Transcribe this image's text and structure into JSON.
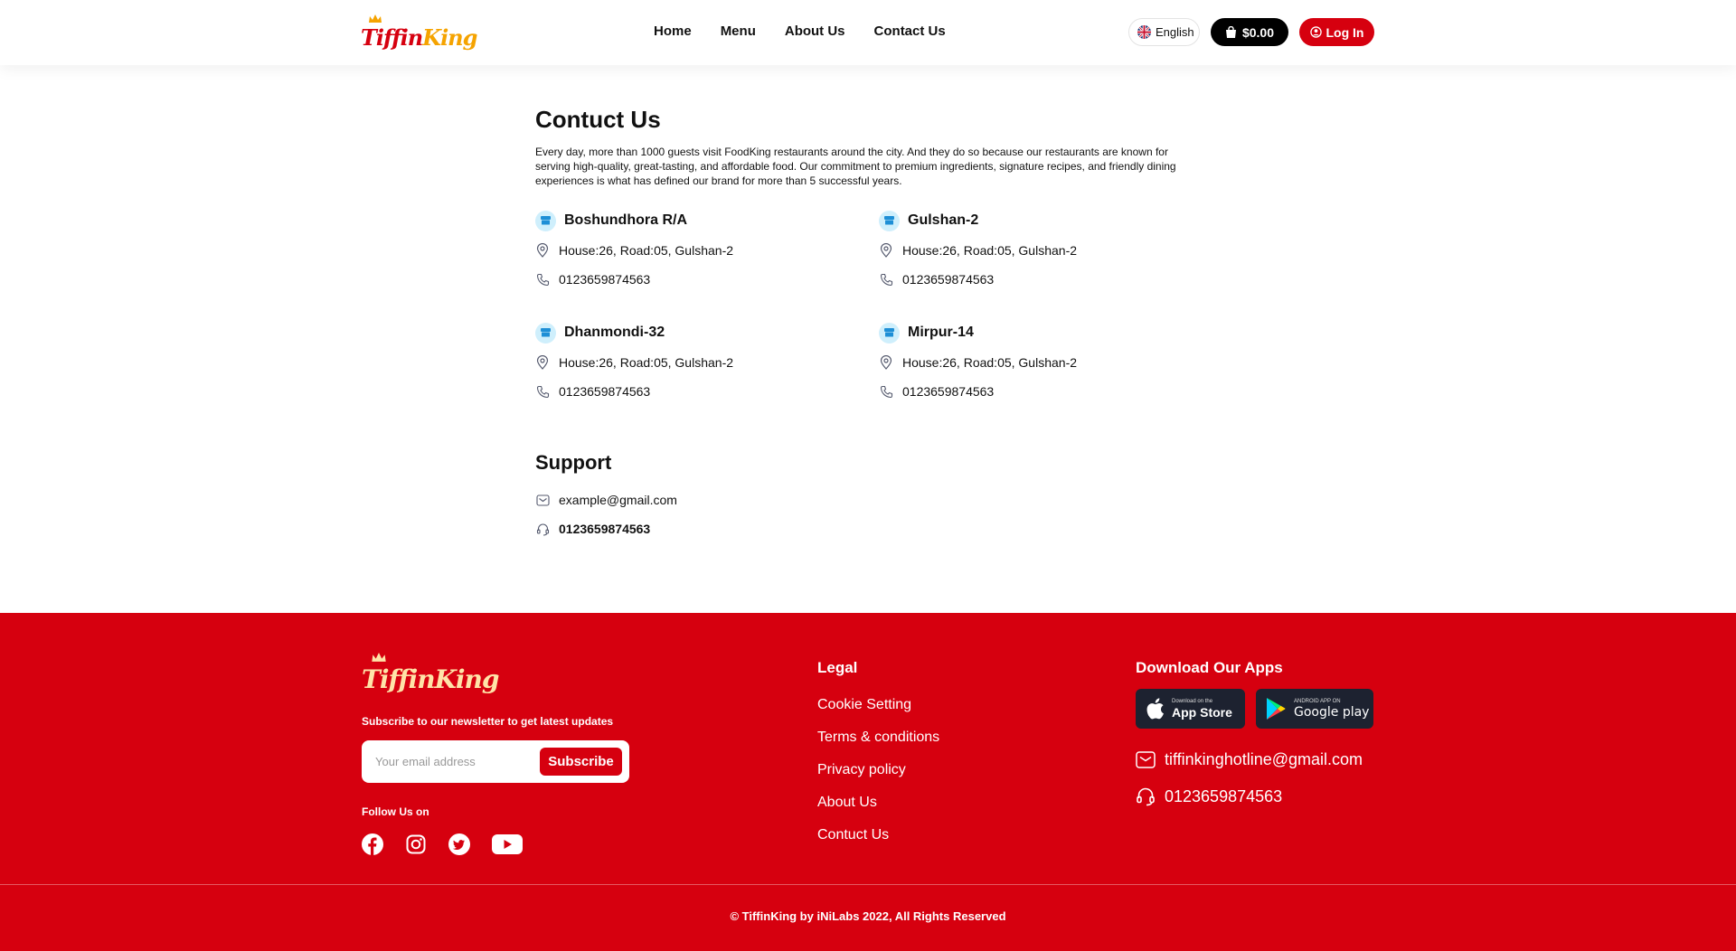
{
  "header": {
    "logo_text_a": "Tiffin",
    "logo_text_b": "King",
    "nav": [
      "Home",
      "Menu",
      "About Us",
      "Contact Us"
    ],
    "language": "English",
    "cart_total": "$0.00",
    "login_label": "Log In"
  },
  "main": {
    "title": "Contuct Us",
    "intro": "Every day, more than 1000 guests visit FoodKing restaurants around the city. And they do so because our restaurants are known for serving high-quality, great-tasting, and affordable food. Our commitment to premium ingredients, signature recipes, and friendly dining experiences is what has defined our brand for more than 5 successful years.",
    "branches": [
      {
        "name": "Boshundhora R/A",
        "address": "House:26, Road:05, Gulshan-2",
        "phone": "0123659874563"
      },
      {
        "name": "Gulshan-2",
        "address": "House:26, Road:05, Gulshan-2",
        "phone": "0123659874563"
      },
      {
        "name": "Dhanmondi-32",
        "address": "House:26, Road:05, Gulshan-2",
        "phone": "0123659874563"
      },
      {
        "name": "Mirpur-14",
        "address": "House:26, Road:05, Gulshan-2",
        "phone": "0123659874563"
      }
    ],
    "support": {
      "title": "Support",
      "email": "example@gmail.com",
      "phone": "0123659874563"
    }
  },
  "footer": {
    "logo_text_a": "Tiffin",
    "logo_text_b": "King",
    "newsletter_label": "Subscribe to our newsletter to get latest updates",
    "email_placeholder": "Your email address",
    "subscribe_label": "Subscribe",
    "follow_label": "Follow Us on",
    "socials": [
      "facebook-icon",
      "instagram-icon",
      "twitter-icon",
      "youtube-icon"
    ],
    "legal_title": "Legal",
    "legal_links": [
      "Cookie Setting",
      "Terms & conditions",
      "Privacy policy",
      "About Us",
      "Contuct Us"
    ],
    "apps_title": "Download Our Apps",
    "app_store": {
      "small": "Download on the",
      "big": "App Store"
    },
    "google_play": {
      "small": "ANDROID APP ON",
      "big": "Google play"
    },
    "hotline_email": "tiffinkinghotline@gmail.com",
    "hotline_phone": "0123659874563",
    "copyright": "© TiffinKing by iNiLabs 2022, All Rights Reserved"
  },
  "colors": {
    "brand_red": "#d6000f",
    "brand_orange": "#f5a300",
    "icon_bg": "#cfeffc",
    "store_button": "#1d2230"
  }
}
